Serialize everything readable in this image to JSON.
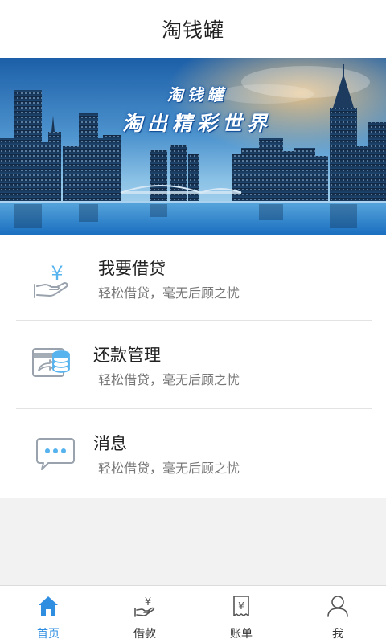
{
  "header": {
    "title": "淘钱罐"
  },
  "banner": {
    "line1": "淘钱罐",
    "line2": "淘出精彩世界"
  },
  "menu": {
    "items": [
      {
        "title": "我要借贷",
        "subtitle": "轻松借贷，毫无后顾之忧",
        "icon": "loan-hand-icon"
      },
      {
        "title": "还款管理",
        "subtitle": "轻松借贷，毫无后顾之忧",
        "icon": "repay-coins-icon"
      },
      {
        "title": "消息",
        "subtitle": "轻松借贷，毫无后顾之忧",
        "icon": "message-bubble-icon"
      }
    ]
  },
  "tabbar": {
    "tabs": [
      {
        "label": "首页",
        "icon": "home-icon",
        "active": true
      },
      {
        "label": "借款",
        "icon": "borrow-icon",
        "active": false
      },
      {
        "label": "账单",
        "icon": "bill-icon",
        "active": false
      },
      {
        "label": "我",
        "icon": "user-icon",
        "active": false
      }
    ]
  },
  "colors": {
    "accent": "#2f8ee0",
    "icon_blue": "#56b3ee",
    "icon_gray": "#9aa3ad"
  }
}
